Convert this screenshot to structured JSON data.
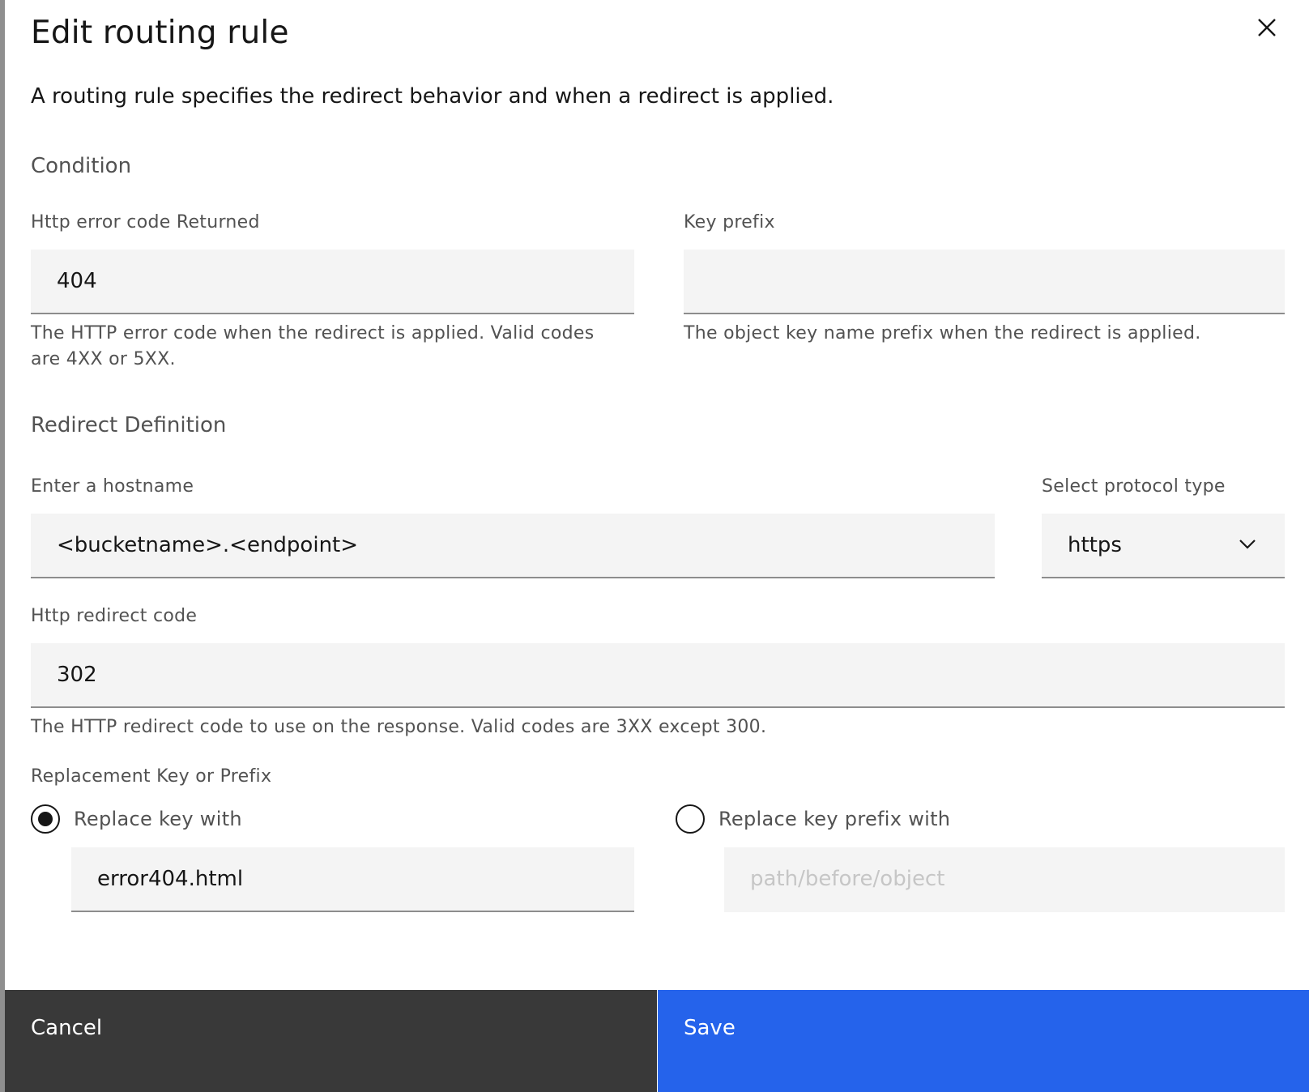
{
  "modal": {
    "title": "Edit routing rule",
    "description": "A routing rule specifies the redirect behavior and when a redirect is applied."
  },
  "condition": {
    "section_label": "Condition",
    "http_error_code": {
      "label": "Http error code Returned",
      "value": "404",
      "helper": "The HTTP error code when the redirect is applied. Valid codes are 4XX or 5XX."
    },
    "key_prefix": {
      "label": "Key prefix",
      "value": "",
      "helper": "The object key name prefix when the redirect is applied."
    }
  },
  "redirect": {
    "section_label": "Redirect Definition",
    "hostname": {
      "label": "Enter a hostname",
      "value": "<bucketname>.<endpoint>"
    },
    "protocol": {
      "label": "Select protocol type",
      "selected": "https"
    },
    "redirect_code": {
      "label": "Http redirect code",
      "value": "302",
      "helper": "The HTTP redirect code to use on the response. Valid codes are 3XX except 300."
    },
    "replacement": {
      "label": "Replacement Key or Prefix",
      "replace_key": {
        "label": "Replace key with",
        "checked": true,
        "value": "error404.html"
      },
      "replace_prefix": {
        "label": "Replace key prefix with",
        "checked": false,
        "placeholder": "path/before/object"
      }
    }
  },
  "footer": {
    "cancel_label": "Cancel",
    "save_label": "Save"
  },
  "colors": {
    "primary": "#2563eb",
    "secondary": "#393939",
    "field_bg": "#f4f4f4"
  }
}
